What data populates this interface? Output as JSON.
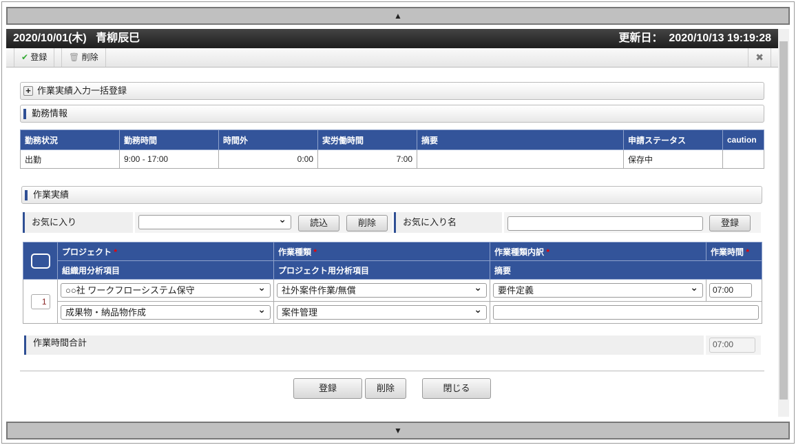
{
  "nav": {
    "up": "▲",
    "down": "▼"
  },
  "title": {
    "date": "2020/10/01(木)",
    "name": "青柳辰巳",
    "updated_label": "更新日：",
    "updated": "2020/10/13 19:19:28"
  },
  "toolbar": {
    "register": "登録",
    "delete": "削除",
    "close": "✖"
  },
  "bulk": {
    "label": "作業実績入力一括登録"
  },
  "attendance": {
    "title": "勤務情報",
    "headers": [
      "勤務状況",
      "勤務時間",
      "時間外",
      "実労働時間",
      "摘要",
      "申請ステータス",
      "caution"
    ],
    "row": [
      "出勤",
      "9:00 - 17:00",
      "0:00",
      "7:00",
      "",
      "保存中",
      ""
    ]
  },
  "work": {
    "title": "作業実績",
    "favorite": {
      "label": "お気に入り",
      "load": "読込",
      "delete": "削除",
      "name_label": "お気に入り名",
      "register": "登録",
      "selected": "",
      "name_value": ""
    },
    "headers": {
      "project": "プロジェクト",
      "work_type": "作業種類",
      "work_detail": "作業種類内訳",
      "work_time": "作業時間",
      "org_item": "組織用分析項目",
      "proj_item": "プロジェクト用分析項目",
      "summary": "摘要",
      "required": "*"
    },
    "row": {
      "no": "1",
      "project": "○○社 ワークフローシステム保守",
      "work_type": "社外案件作業/無償",
      "work_detail": "要件定義",
      "time": "07:00",
      "org_item": "成果物・納品物作成",
      "proj_item": "案件管理",
      "summary": ""
    },
    "total_label": "作業時間合計",
    "total": "07:00"
  },
  "footer": {
    "register": "登録",
    "delete": "削除",
    "close": "閉じる"
  }
}
